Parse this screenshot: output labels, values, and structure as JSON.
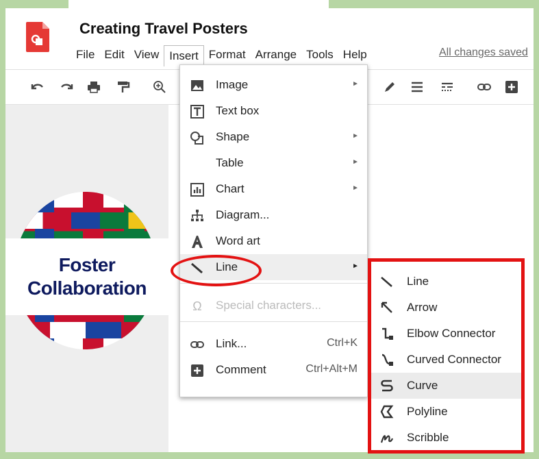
{
  "document": {
    "title": "Creating Travel Posters",
    "save_status": "All changes saved"
  },
  "menubar": [
    "File",
    "Edit",
    "View",
    "Insert",
    "Format",
    "Arrange",
    "Tools",
    "Help"
  ],
  "toolbar": {
    "icons": [
      "undo-icon",
      "redo-icon",
      "print-icon",
      "paint-format-icon",
      "zoom-icon",
      "pen-icon",
      "align-icon",
      "line-dash-icon",
      "link-icon",
      "add-comment-icon"
    ]
  },
  "canvas": {
    "overlay_text_line1": "Foster",
    "overlay_text_line2": "Collaboration"
  },
  "insert_menu": {
    "items": [
      {
        "label": "Image",
        "icon": "image-icon",
        "has_submenu": true
      },
      {
        "label": "Text box",
        "icon": "text-box-icon",
        "has_submenu": false
      },
      {
        "label": "Shape",
        "icon": "shape-icon",
        "has_submenu": true
      },
      {
        "label": "Table",
        "icon": "",
        "has_submenu": true
      },
      {
        "label": "Chart",
        "icon": "chart-icon",
        "has_submenu": true
      },
      {
        "label": "Diagram...",
        "icon": "diagram-icon",
        "has_submenu": false
      },
      {
        "label": "Word art",
        "icon": "word-art-icon",
        "has_submenu": false
      },
      {
        "label": "Line",
        "icon": "line-icon",
        "has_submenu": true,
        "highlighted": true
      },
      {
        "label": "Special characters...",
        "icon": "omega-icon",
        "disabled": true
      },
      {
        "label": "Link...",
        "icon": "link-icon",
        "shortcut": "Ctrl+K"
      },
      {
        "label": "Comment",
        "icon": "comment-icon",
        "shortcut": "Ctrl+Alt+M"
      }
    ]
  },
  "line_submenu": {
    "items": [
      {
        "label": "Line",
        "icon": "line-icon"
      },
      {
        "label": "Arrow",
        "icon": "arrow-icon"
      },
      {
        "label": "Elbow Connector",
        "icon": "elbow-connector-icon"
      },
      {
        "label": "Curved Connector",
        "icon": "curved-connector-icon"
      },
      {
        "label": "Curve",
        "icon": "curve-icon",
        "highlighted": true
      },
      {
        "label": "Polyline",
        "icon": "polyline-icon"
      },
      {
        "label": "Scribble",
        "icon": "scribble-icon"
      }
    ]
  },
  "colors": {
    "annotation": "#e31212",
    "frame": "#b7d6a4",
    "logo": "#e53935"
  }
}
